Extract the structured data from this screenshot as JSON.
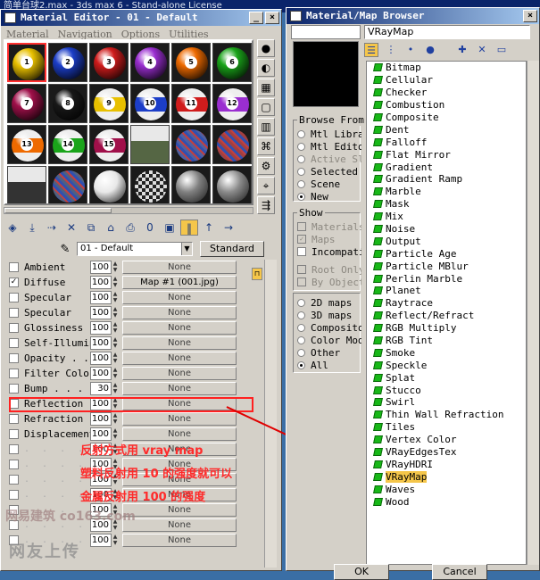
{
  "bg_title": "简单台球2.max - 3ds max 6 - Stand-alone License",
  "editor": {
    "title": "Material Editor - 01 - Default",
    "menu": [
      "Material",
      "Navigation",
      "Options",
      "Utilities"
    ],
    "material_name": "01 - Default",
    "material_type": "Standard",
    "slots": [
      {
        "kind": "ball",
        "color": "#e8c000",
        "num": "1",
        "selected": true
      },
      {
        "kind": "ball",
        "color": "#1c3ec8",
        "num": "2"
      },
      {
        "kind": "ball",
        "color": "#d01c1c",
        "num": "3"
      },
      {
        "kind": "ball",
        "color": "#9a2ed0",
        "num": "4"
      },
      {
        "kind": "ball",
        "color": "#ee6a00",
        "num": "5"
      },
      {
        "kind": "ball",
        "color": "#1aa41a",
        "num": "6"
      },
      {
        "kind": "ball",
        "color": "#a0104a",
        "num": "7"
      },
      {
        "kind": "ball",
        "color": "#181818",
        "num": "8"
      },
      {
        "kind": "stripe",
        "color": "#e8c000",
        "num": "9"
      },
      {
        "kind": "stripe",
        "color": "#1c3ec8",
        "num": "10"
      },
      {
        "kind": "stripe",
        "color": "#d01c1c",
        "num": "11"
      },
      {
        "kind": "stripe",
        "color": "#9a2ed0",
        "num": "12"
      },
      {
        "kind": "stripe",
        "color": "#ee6a00",
        "num": "13"
      },
      {
        "kind": "stripe",
        "color": "#1aa41a",
        "num": "14"
      },
      {
        "kind": "stripe",
        "color": "#a0104a",
        "num": "15"
      },
      {
        "kind": "scene",
        "color": "#556644",
        "num": ""
      },
      {
        "kind": "noise",
        "color": "#5060a0",
        "num": ""
      },
      {
        "kind": "noise",
        "color": "#a04040",
        "num": ""
      },
      {
        "kind": "scene",
        "color": "#333333",
        "num": ""
      },
      {
        "kind": "noise",
        "color": "#506080",
        "num": ""
      },
      {
        "kind": "plain",
        "color": "#e8e8e8",
        "num": ""
      },
      {
        "kind": "checker",
        "color": "#777777",
        "num": ""
      },
      {
        "kind": "plain",
        "color": "#808080",
        "num": ""
      },
      {
        "kind": "plain",
        "color": "#8a8a8a",
        "num": ""
      }
    ],
    "maps": [
      {
        "checked": false,
        "label": "Ambient",
        "amount": "100",
        "map": "None"
      },
      {
        "checked": true,
        "label": "Diffuse",
        "amount": "100",
        "map": "Map #1 (001.jpg)"
      },
      {
        "checked": false,
        "label": "Specular",
        "amount": "100",
        "map": "None"
      },
      {
        "checked": false,
        "label": "Specular",
        "amount": "100",
        "map": "None"
      },
      {
        "checked": false,
        "label": "Glossiness",
        "amount": "100",
        "map": "None"
      },
      {
        "checked": false,
        "label": "Self-Illumin",
        "amount": "100",
        "map": "None"
      },
      {
        "checked": false,
        "label": "Opacity . .",
        "amount": "100",
        "map": "None"
      },
      {
        "checked": false,
        "label": "Filter Color",
        "amount": "100",
        "map": "None"
      },
      {
        "checked": false,
        "label": "Bump . . .",
        "amount": "30",
        "map": "None"
      },
      {
        "checked": false,
        "label": "Reflection",
        "amount": "100",
        "map": "None"
      },
      {
        "checked": false,
        "label": "Refraction",
        "amount": "100",
        "map": "None"
      },
      {
        "checked": false,
        "label": "Displacement",
        "amount": "100",
        "map": "None"
      },
      {
        "checked": false,
        "label": ". . . . . .",
        "amount": "100",
        "map": "None"
      },
      {
        "checked": false,
        "label": ". . . . . .",
        "amount": "100",
        "map": "None"
      },
      {
        "checked": false,
        "label": ". . . . . .",
        "amount": "100",
        "map": "None"
      },
      {
        "checked": false,
        "label": ". . . . . .",
        "amount": "100",
        "map": "None"
      },
      {
        "checked": false,
        "label": ". . . . . .",
        "amount": "100",
        "map": "None"
      },
      {
        "checked": false,
        "label": ". . . . . .",
        "amount": "100",
        "map": "None"
      },
      {
        "checked": false,
        "label": ". . . . . .",
        "amount": "100",
        "map": "None"
      }
    ]
  },
  "annotations": [
    "反射方式用 vray map",
    "塑料反射用 10 的强度就可以",
    "金属反射用 100 的强度"
  ],
  "watermark": {
    "line1": "网易建筑 co163.com",
    "line2": "网友上传"
  },
  "browser": {
    "title": "Material/Map Browser",
    "name_value": "VRayMap",
    "browse_from_label": "Browse From",
    "browse_from": [
      {
        "label": "Mtl Library",
        "on": false,
        "disabled": false
      },
      {
        "label": "Mtl Editor",
        "on": false,
        "disabled": false
      },
      {
        "label": "Active Slot",
        "on": false,
        "disabled": true
      },
      {
        "label": "Selected",
        "on": false,
        "disabled": false
      },
      {
        "label": "Scene",
        "on": false,
        "disabled": false
      },
      {
        "label": "New",
        "on": true,
        "disabled": false
      }
    ],
    "show_label": "Show",
    "show": [
      {
        "label": "Materials",
        "checked": false,
        "disabled": true
      },
      {
        "label": "Maps",
        "checked": true,
        "disabled": true
      },
      {
        "label": "Incompatible",
        "checked": false,
        "disabled": false
      }
    ],
    "show2": [
      {
        "label": "Root Only",
        "checked": false,
        "disabled": true
      },
      {
        "label": "By Object",
        "checked": false,
        "disabled": true
      }
    ],
    "type_radios": [
      {
        "label": "2D maps",
        "on": false
      },
      {
        "label": "3D maps",
        "on": false
      },
      {
        "label": "Compositors",
        "on": false
      },
      {
        "label": "Color Mods",
        "on": false
      },
      {
        "label": "Other",
        "on": false
      },
      {
        "label": "All",
        "on": true
      }
    ],
    "list": [
      "Bitmap",
      "Cellular",
      "Checker",
      "Combustion",
      "Composite",
      "Dent",
      "Falloff",
      "Flat Mirror",
      "Gradient",
      "Gradient Ramp",
      "Marble",
      "Mask",
      "Mix",
      "Noise",
      "Output",
      "Particle Age",
      "Particle MBlur",
      "Perlin Marble",
      "Planet",
      "Raytrace",
      "Reflect/Refract",
      "RGB Multiply",
      "RGB Tint",
      "Smoke",
      "Speckle",
      "Splat",
      "Stucco",
      "Swirl",
      "Thin Wall Refraction",
      "Tiles",
      "Vertex Color",
      "VRayEdgesTex",
      "VRayHDRI",
      "VRayMap",
      "Waves",
      "Wood"
    ],
    "highlighted": "VRayMap",
    "ok_label": "OK",
    "cancel_label": "Cancel"
  },
  "colors": {
    "accent": "#f5c64a",
    "annotation": "#ff2a2a",
    "titlebar": "#0a246a"
  }
}
